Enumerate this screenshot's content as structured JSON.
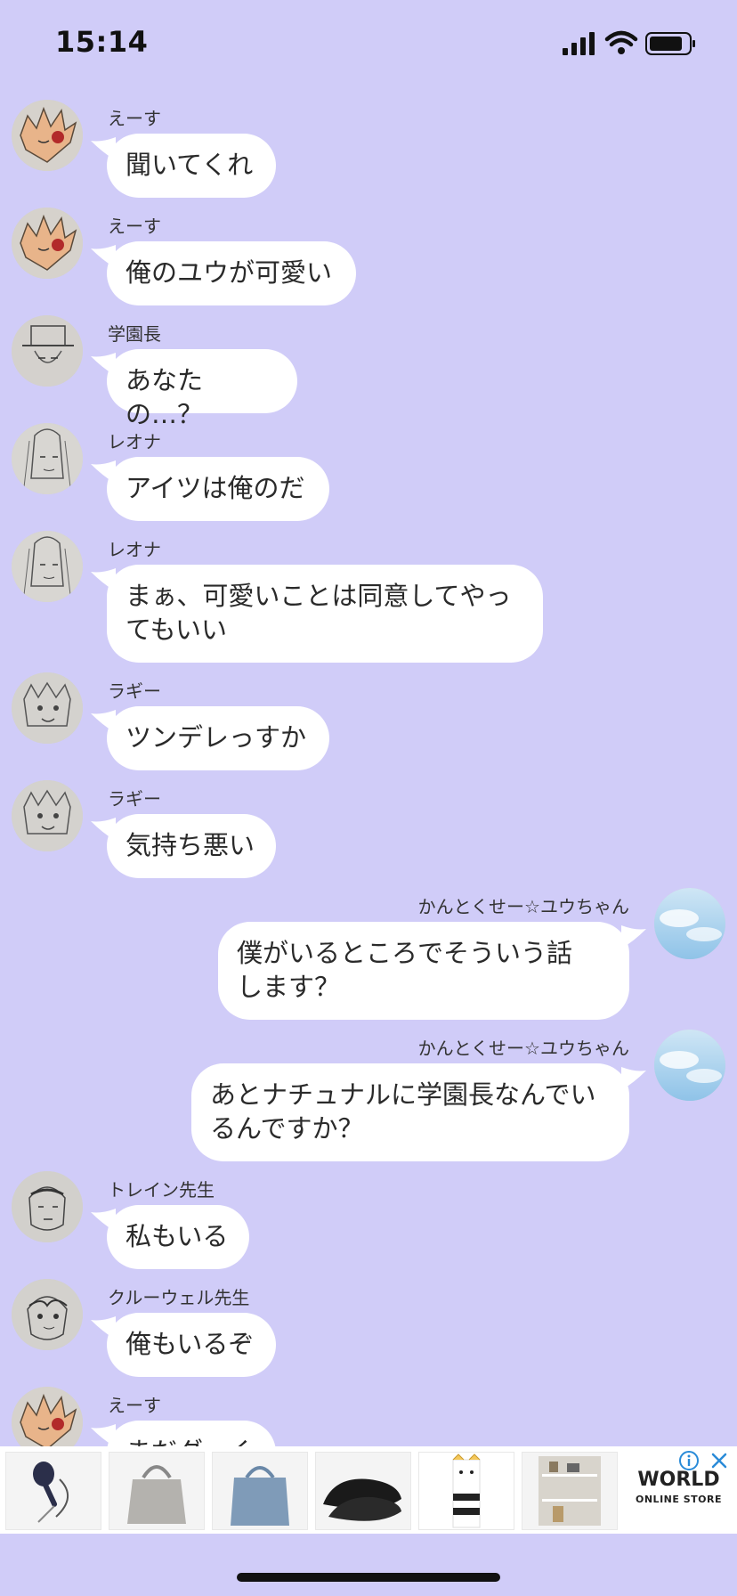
{
  "status": {
    "time": "15:14"
  },
  "messages": [
    {
      "side": "left",
      "sender": "えーす",
      "text": "聞いてくれ",
      "avatar": "ace"
    },
    {
      "side": "left",
      "sender": "えーす",
      "text": "俺のユウが可愛い",
      "avatar": "ace"
    },
    {
      "side": "left",
      "sender": "学園長",
      "text": "あなたの…？",
      "avatar": "headmaster"
    },
    {
      "side": "left",
      "sender": "レオナ",
      "text": "アイツは俺のだ",
      "avatar": "leona"
    },
    {
      "side": "left",
      "sender": "レオナ",
      "text": "まぁ、可愛いことは同意してやっ\nてもいい",
      "avatar": "leona"
    },
    {
      "side": "left",
      "sender": "ラギー",
      "text": "ツンデレっすか",
      "avatar": "ruggie"
    },
    {
      "side": "left",
      "sender": "ラギー",
      "text": "気持ち悪い",
      "avatar": "ruggie"
    },
    {
      "side": "right",
      "sender": "かんとくせー☆ユウちゃん",
      "text": "僕がいるところでそういう話\nします？",
      "avatar": "sky"
    },
    {
      "side": "right",
      "sender": "かんとくせー☆ユウちゃん",
      "text": "あとナチュナルに学園長なんでい\nるんですか？",
      "avatar": "sky"
    },
    {
      "side": "left",
      "sender": "トレイン先生",
      "text": "私もいる",
      "avatar": "trein"
    },
    {
      "side": "left",
      "sender": "クルーウェル先生",
      "text": "俺もいるぞ",
      "avatar": "crewel"
    },
    {
      "side": "left",
      "sender": "えーす",
      "text": "まだダ…く",
      "avatar": "ace"
    }
  ],
  "ad": {
    "brand_line1": "WORLD",
    "brand_line2": "ONLINE STORE",
    "items": [
      "handheld-fan",
      "gray-tote-bag",
      "blue-tote-bag",
      "black-flat-shoes",
      "cat-socks",
      "storage-rack"
    ]
  },
  "colors": {
    "background": "#d0ccf8",
    "bubble": "#ffffff",
    "text": "#2a2a2a",
    "sender": "#333333"
  }
}
